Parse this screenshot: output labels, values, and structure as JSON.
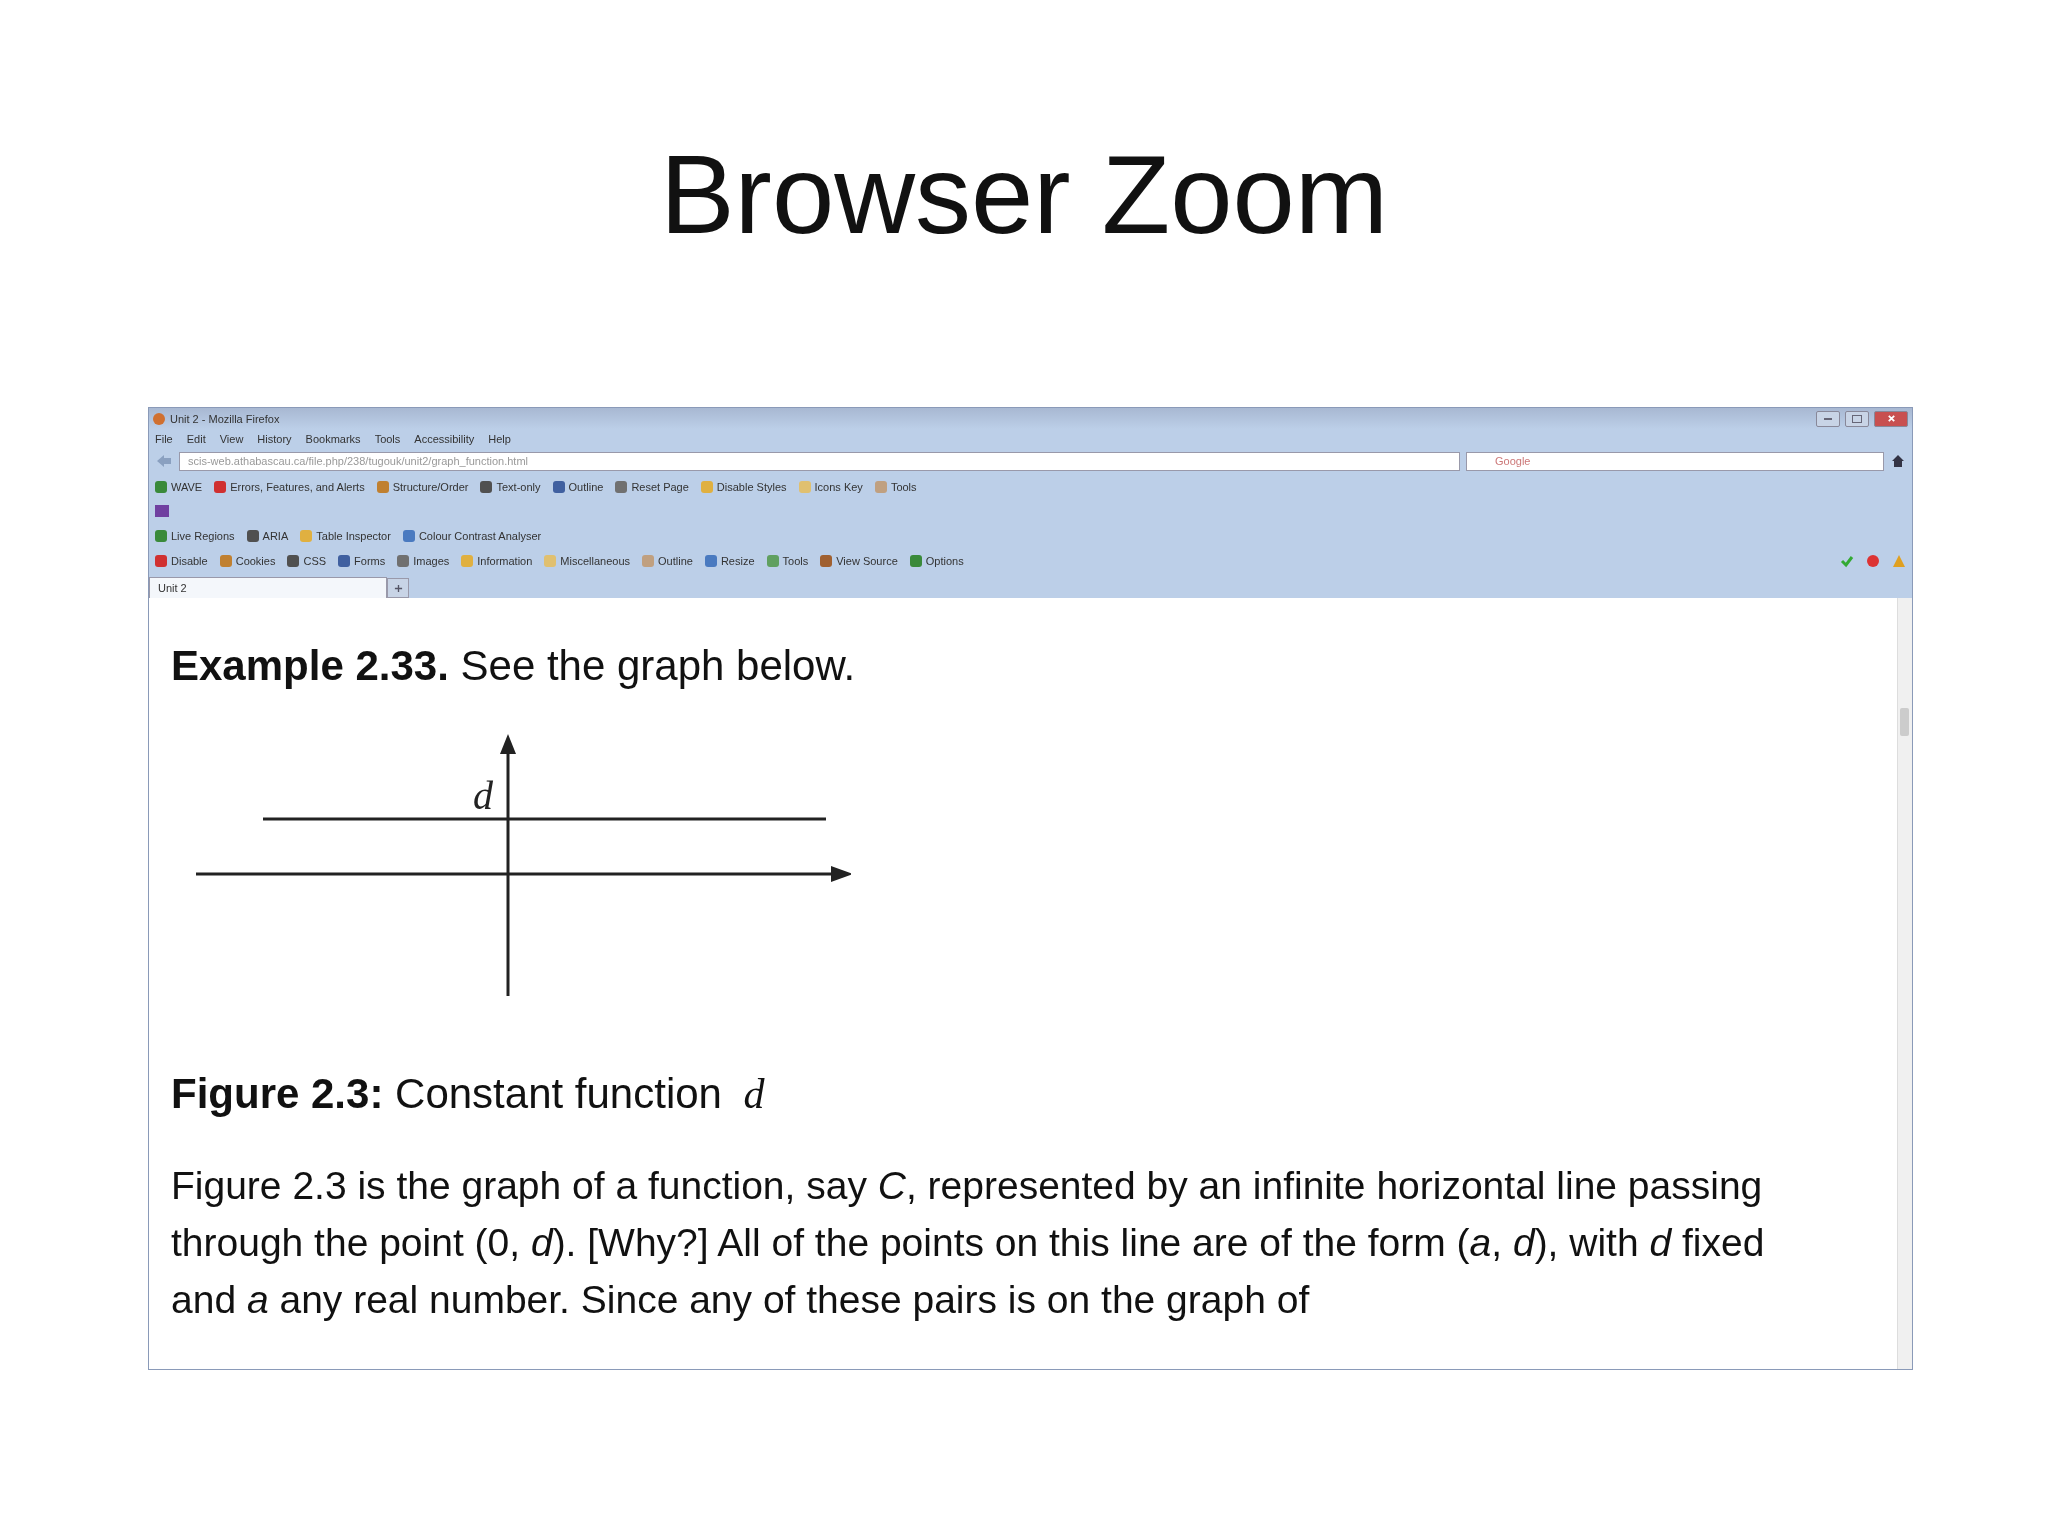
{
  "slide_title": "Browser Zoom",
  "browser": {
    "window_title": "Unit 2 - Mozilla Firefox",
    "menu": [
      "File",
      "Edit",
      "View",
      "History",
      "Bookmarks",
      "Tools",
      "Accessibility",
      "Help"
    ],
    "address": "scis-web.athabascau.ca/file.php/238/tugouk/unit2/graph_function.html",
    "search_placeholder": "Google",
    "wave_toolbar": [
      "WAVE",
      "Errors, Features, and Alerts",
      "Structure/Order",
      "Text-only",
      "Outline",
      "Reset Page",
      "Disable Styles",
      "Icons Key",
      "Tools"
    ],
    "accessibility_toolbar": [
      "Live Regions",
      "ARIA",
      "Table Inspector",
      "Colour Contrast Analyser"
    ],
    "developer_toolbar": [
      "Disable",
      "Cookies",
      "CSS",
      "Forms",
      "Images",
      "Information",
      "Miscellaneous",
      "Outline",
      "Resize",
      "Tools",
      "View Source",
      "Options"
    ],
    "tabs": [
      {
        "label": "Unit 2",
        "selected": true
      }
    ]
  },
  "page": {
    "example_label": "Example 2.33.",
    "example_text": "See the graph below.",
    "graph_label": "d",
    "figure_label": "Figure 2.3:",
    "figure_text": "Constant function",
    "figure_var": "d",
    "paragraph": "Figure 2.3 is the graph of a function, say *C*, represented by an infinite horizontal line passing through the point (0, *d*). [Why?] All of the points on this line are of the form (*a*, *d*), with *d* fixed and *a* any real number. Since any of these pairs is on the graph of"
  }
}
